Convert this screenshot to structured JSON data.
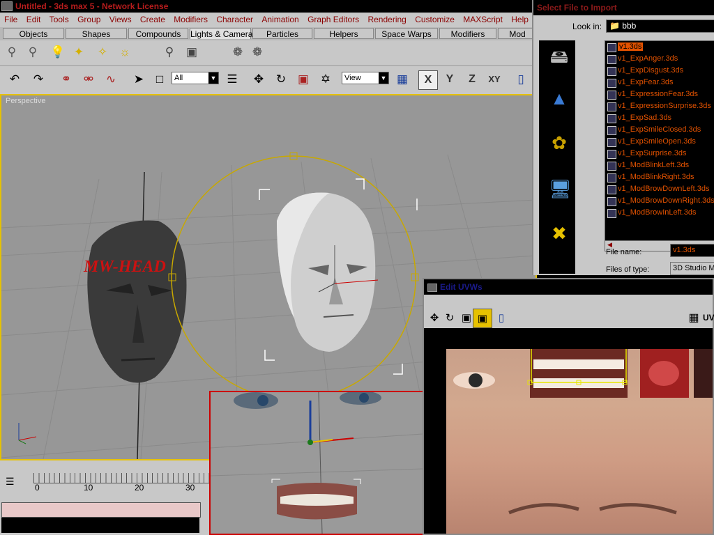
{
  "app": {
    "title": "Untitled - 3ds max 5 - Network License",
    "menus": [
      "File",
      "Edit",
      "Tools",
      "Group",
      "Views",
      "Create",
      "Modifiers",
      "Character",
      "Animation",
      "Graph Editors",
      "Rendering",
      "Customize",
      "MAXScript",
      "Help"
    ],
    "tabs": [
      "Objects",
      "Shapes",
      "Compounds",
      "Lights & Cameras",
      "Particles",
      "Helpers",
      "Space Warps",
      "Modifiers",
      "Mod"
    ],
    "active_tab": "Lights & Cameras",
    "selection_filter": "All",
    "coord_system": "View",
    "axis_buttons": [
      "X",
      "Y",
      "Z",
      "XY"
    ],
    "viewport_label": "Perspective",
    "scene_text": "MW-HEAD",
    "timeline_ticks": [
      "0",
      "10",
      "20",
      "30"
    ]
  },
  "file_dialog": {
    "title": "Select File to Import",
    "look_in_label": "Look in:",
    "look_in_value": "bbb",
    "files": [
      "v1.3ds",
      "v1_ExpAnger.3ds",
      "v1_ExpDisgust.3ds",
      "v1_ExpFear.3ds",
      "v1_ExpressionFear.3ds",
      "v1_ExpressionSurprise.3ds",
      "v1_ExpSad.3ds",
      "v1_ExpSmileClosed.3ds",
      "v1_ExpSmileOpen.3ds",
      "v1_ExpSurprise.3ds",
      "v1_ModBlinkLeft.3ds",
      "v1_ModBlinkRight.3ds",
      "v1_ModBrowDownLeft.3ds",
      "v1_ModBrowDownRight.3ds",
      "v1_ModBrowInLeft.3ds"
    ],
    "selected_file": "v1.3ds",
    "file_name_label": "File name:",
    "file_name_value": "v1.3ds",
    "files_of_type_label": "Files of type:",
    "files_of_type_value": "3D Studio M"
  },
  "uvw_editor": {
    "title": "Edit UVWs",
    "uv_label": "UV"
  },
  "colors": {
    "title_red": "#b71c1c",
    "file_orange": "#e35200",
    "viewport_border": "#e6c100",
    "scene_text_red": "#cc1111"
  }
}
